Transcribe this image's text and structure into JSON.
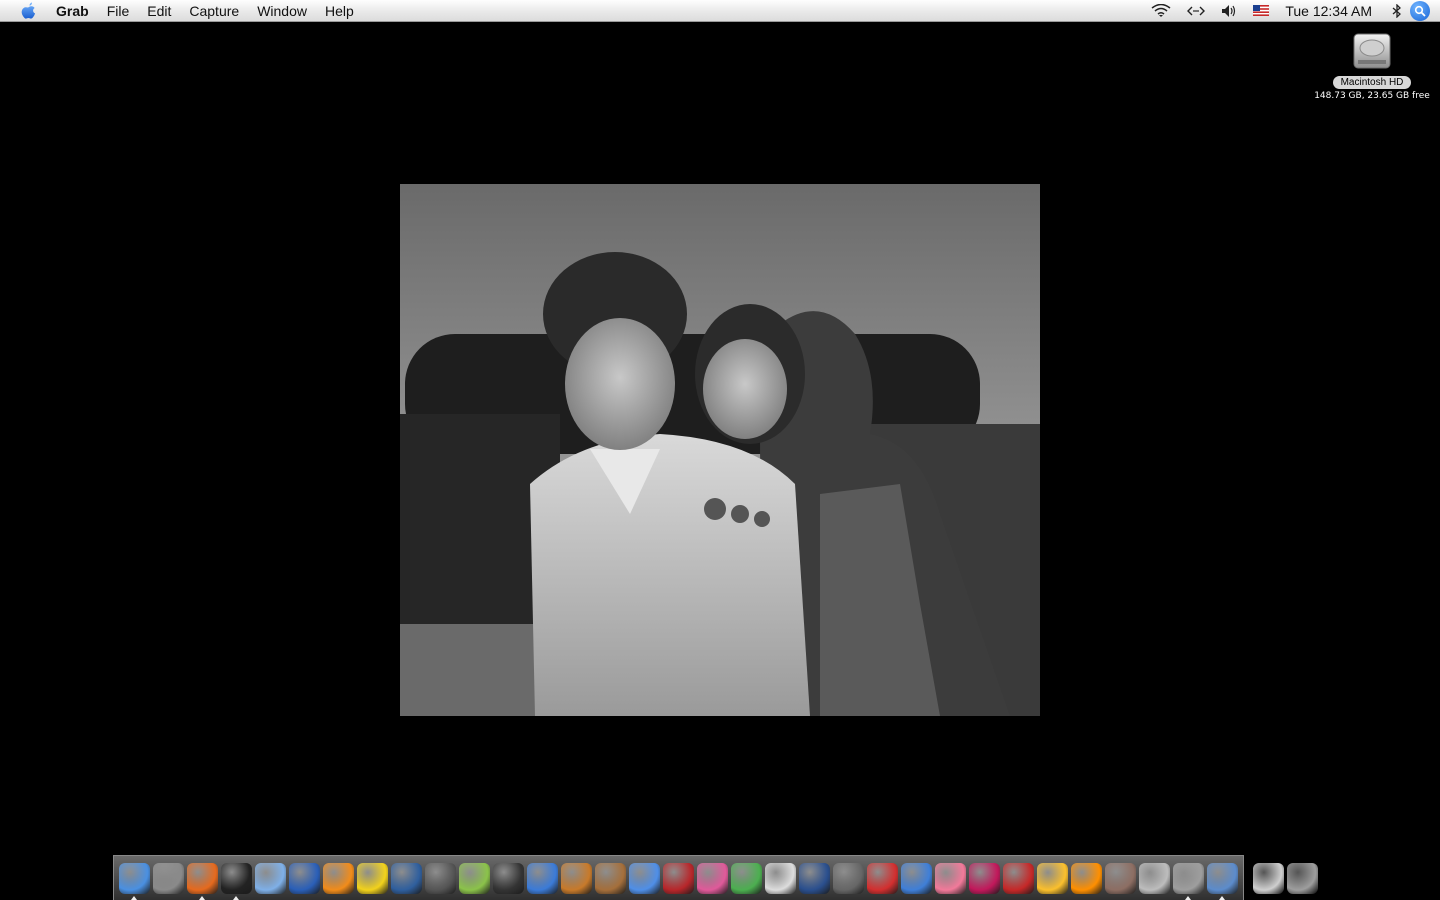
{
  "menubar": {
    "app_name": "Grab",
    "items": [
      "File",
      "Edit",
      "Capture",
      "Window",
      "Help"
    ],
    "clock": "Tue 12:34 AM"
  },
  "desktop": {
    "hd_label": "Macintosh HD",
    "hd_info": "148.73 GB, 23.65 GB free"
  },
  "photo": {
    "subject": "Black and white photo of two children on a sofa"
  },
  "dock": {
    "apps": [
      {
        "name": "finder-icon",
        "color": "#4a90e2",
        "running": true
      },
      {
        "name": "preview-icon",
        "color": "#8a8a8a",
        "running": false
      },
      {
        "name": "firefox-icon",
        "color": "#e66a1e",
        "running": true
      },
      {
        "name": "dashboard-icon",
        "color": "#222222",
        "running": true
      },
      {
        "name": "itunes-icon",
        "color": "#7fb0e8",
        "running": false
      },
      {
        "name": "fetch-ff-icon",
        "color": "#2a5fb8",
        "running": false
      },
      {
        "name": "vlc-icon",
        "color": "#f28c1a",
        "running": false
      },
      {
        "name": "cyberduck-icon",
        "color": "#f2d21c",
        "running": false
      },
      {
        "name": "app-blue-icon",
        "color": "#2f5f9e",
        "running": false
      },
      {
        "name": "app-gray-icon",
        "color": "#555555",
        "running": false
      },
      {
        "name": "app-green-icon",
        "color": "#8bc34a",
        "running": false
      },
      {
        "name": "amazon-icon",
        "color": "#333333",
        "running": false
      },
      {
        "name": "imovie-icon",
        "color": "#3b7bd8",
        "running": false
      },
      {
        "name": "garageband-icon",
        "color": "#c87a2a",
        "running": false
      },
      {
        "name": "iphoto-icon",
        "color": "#a56f3b",
        "running": false
      },
      {
        "name": "ichat-icon",
        "color": "#4f8fe8",
        "running": false
      },
      {
        "name": "app-red-icon",
        "color": "#b8262a",
        "running": false
      },
      {
        "name": "comic-life-icon",
        "color": "#e05a9a",
        "running": false
      },
      {
        "name": "hand-icon",
        "color": "#4caf50",
        "running": false
      },
      {
        "name": "app-balls-icon",
        "color": "#dddddd",
        "running": false
      },
      {
        "name": "flash-icon",
        "color": "#2a4f8e",
        "running": false
      },
      {
        "name": "app-bug-icon",
        "color": "#666666",
        "running": false
      },
      {
        "name": "monopoly-icon",
        "color": "#d32f2f",
        "running": false
      },
      {
        "name": "globe-icon",
        "color": "#3f7fd8",
        "running": false
      },
      {
        "name": "game-kid-icon",
        "color": "#f27a9a",
        "running": false
      },
      {
        "name": "cake-mania-icon",
        "color": "#c2185b",
        "running": false
      },
      {
        "name": "game-red-icon",
        "color": "#c62828",
        "running": false
      },
      {
        "name": "bird-icon",
        "color": "#fbc02d",
        "running": false
      },
      {
        "name": "turbo-icon",
        "color": "#ff8f00",
        "running": false
      },
      {
        "name": "tribe-icon",
        "color": "#8d6e63",
        "running": false
      },
      {
        "name": "app-doc-icon",
        "color": "#bdbdbd",
        "running": false
      },
      {
        "name": "app-x-icon",
        "color": "#9e9e9e",
        "running": true
      },
      {
        "name": "grab-icon",
        "color": "#5c8ccc",
        "running": true
      }
    ],
    "right_items": [
      {
        "name": "downloads-folder-icon",
        "color": "#cfcfcf"
      },
      {
        "name": "trash-icon",
        "color": "#9e9e9e"
      }
    ]
  }
}
